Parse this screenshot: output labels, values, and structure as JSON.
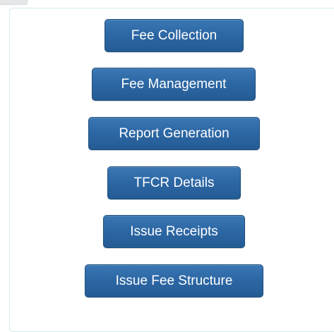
{
  "menu": {
    "buttons": [
      {
        "label": "Fee Collection"
      },
      {
        "label": "Fee Management"
      },
      {
        "label": "Report Generation"
      },
      {
        "label": "TFCR Details"
      },
      {
        "label": "Issue Receipts"
      },
      {
        "label": "Issue Fee Structure"
      }
    ]
  },
  "colors": {
    "button_background": "#2d68a5",
    "button_border": "#1e4e7e",
    "button_text": "#ffffff",
    "panel_border": "#d2ecef",
    "page_background": "#ffffff"
  }
}
